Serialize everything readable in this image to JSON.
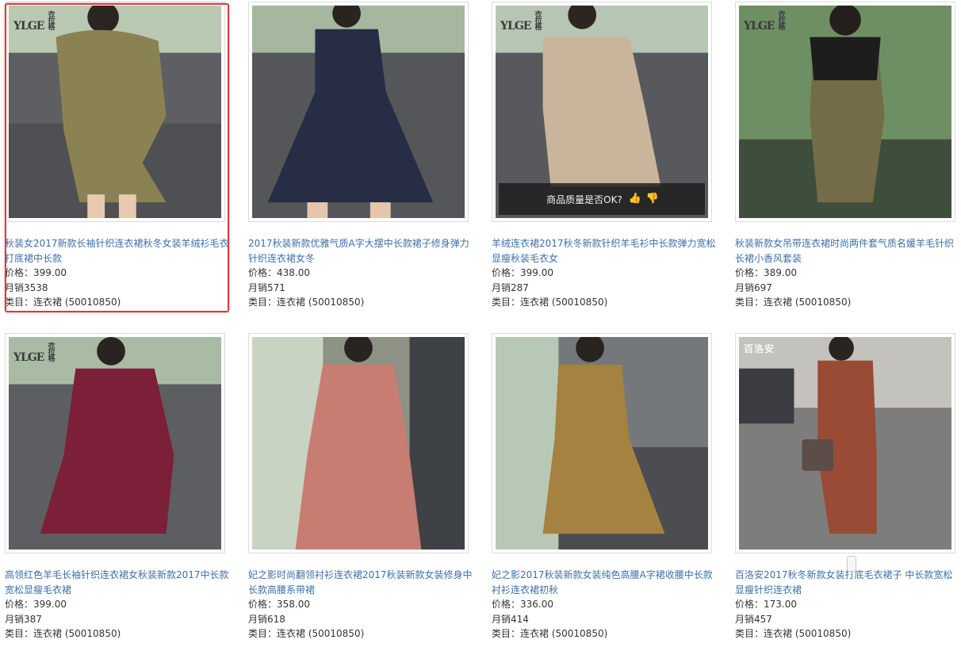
{
  "products": [
    {
      "title": "秋装女2017新款长袖针织连衣裙秋冬女装羊绒衫毛衣打底裙中长款",
      "price_label": "价格：",
      "price": "399.00",
      "sales_label": "月销",
      "sales": "3538",
      "cat_label": "类目：",
      "category": "连衣裙 (50010850)",
      "logo": "YLGE",
      "logo_sub": "衣拉格"
    },
    {
      "title": "2017秋装新款优雅气质A字大摆中长款裙子修身弹力针织连衣裙女冬",
      "price_label": "价格：",
      "price": "438.00",
      "sales_label": "月销",
      "sales": "571",
      "cat_label": "类目：",
      "category": "连衣裙 (50010850)",
      "logo": "",
      "logo_sub": ""
    },
    {
      "title": "羊绒连衣裙2017秋冬新款针织羊毛衫中长款弹力宽松显瘦秋装毛衣女",
      "price_label": "价格：",
      "price": "399.00",
      "sales_label": "月销",
      "sales": "287",
      "cat_label": "类目：",
      "category": "连衣裙 (50010850)",
      "logo": "YLGE",
      "logo_sub": "衣拉格"
    },
    {
      "title": "秋装新款女吊带连衣裙时尚两件套气质名媛羊毛针织长裙小香风套装",
      "price_label": "价格：",
      "price": "389.00",
      "sales_label": "月销",
      "sales": "697",
      "cat_label": "类目：",
      "category": "连衣裙 (50010850)",
      "logo": "YLGE",
      "logo_sub": "衣拉格"
    },
    {
      "title": "高领红色羊毛长袖针织连衣裙女秋装新款2017中长款宽松显瘦毛衣裙",
      "price_label": "价格：",
      "price": "399.00",
      "sales_label": "月销",
      "sales": "387",
      "cat_label": "类目：",
      "category": "连衣裙 (50010850)",
      "logo": "YLGE",
      "logo_sub": "衣拉格"
    },
    {
      "title": "妃之影时尚翻领衬衫连衣裙2017秋装新款女装修身中长款高腰系带裙",
      "price_label": "价格：",
      "price": "358.00",
      "sales_label": "月销",
      "sales": "618",
      "cat_label": "类目：",
      "category": "连衣裙 (50010850)",
      "logo": "",
      "logo_sub": ""
    },
    {
      "title": "妃之影2017秋装新款女装纯色高腰A字裙收腰中长款衬衫连衣裙初秋",
      "price_label": "价格：",
      "price": "336.00",
      "sales_label": "月销",
      "sales": "414",
      "cat_label": "类目：",
      "category": "连衣裙 (50010850)",
      "logo": "",
      "logo_sub": ""
    },
    {
      "title": "百洛安2017秋冬新款女装打底毛衣裙子 中长款宽松显瘦针织连衣裙",
      "price_label": "价格：",
      "price": "173.00",
      "sales_label": "月销",
      "sales": "457",
      "cat_label": "类目：",
      "category": "连衣裙 (50010850)",
      "logo": "百洛安",
      "logo_sub": ""
    }
  ],
  "feedback_overlay": {
    "text": "商品质量是否OK?",
    "up_icon": "thumbs-up-icon",
    "down_icon": "thumbs-down-icon"
  },
  "colors": {
    "link": "#3b6fa8",
    "selected_border": "#d93b3b",
    "text": "#333333"
  }
}
